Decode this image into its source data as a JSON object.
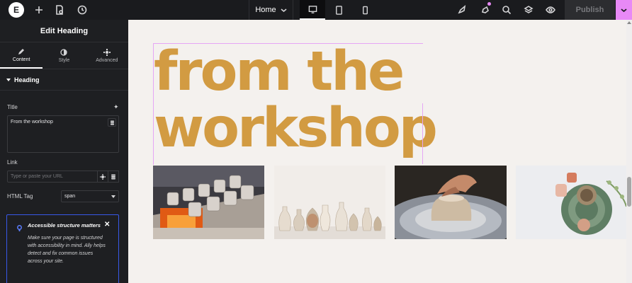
{
  "topbar": {
    "logo": "E",
    "page_name": "Home",
    "publish_label": "Publish",
    "icons": [
      "plus-icon",
      "page-settings-icon",
      "history-icon",
      "rocket-icon",
      "whats-new-icon",
      "search-icon",
      "layers-icon",
      "preview-eye-icon"
    ],
    "devices": [
      "desktop-icon",
      "tablet-icon",
      "mobile-icon"
    ],
    "accent": "#e889f6"
  },
  "panel": {
    "title": "Edit Heading",
    "tabs": [
      {
        "label": "Content",
        "icon": "pencil-icon",
        "active": true
      },
      {
        "label": "Style",
        "icon": "half-circle-icon",
        "active": false
      },
      {
        "label": "Advanced",
        "icon": "gear-icon",
        "active": false
      }
    ],
    "section": "Heading",
    "title_label": "Title",
    "title_value": "From the workshop",
    "link_label": "Link",
    "link_placeholder": "Type or paste your URL",
    "html_tag_label": "HTML Tag",
    "html_tag_value": "span",
    "notice": {
      "title": "Accessible structure matters",
      "body": "Make sure your page is structured with accessibility in mind. Ally helps detect and fix common issues across your site."
    }
  },
  "canvas": {
    "heading_line1": "from the",
    "heading_line2": "workshop",
    "heading_color": "#d29b42",
    "photos": [
      "kiln-pottery-photo",
      "vases-collection-photo",
      "pottery-wheel-photo",
      "ceramic-plates-photo"
    ]
  }
}
